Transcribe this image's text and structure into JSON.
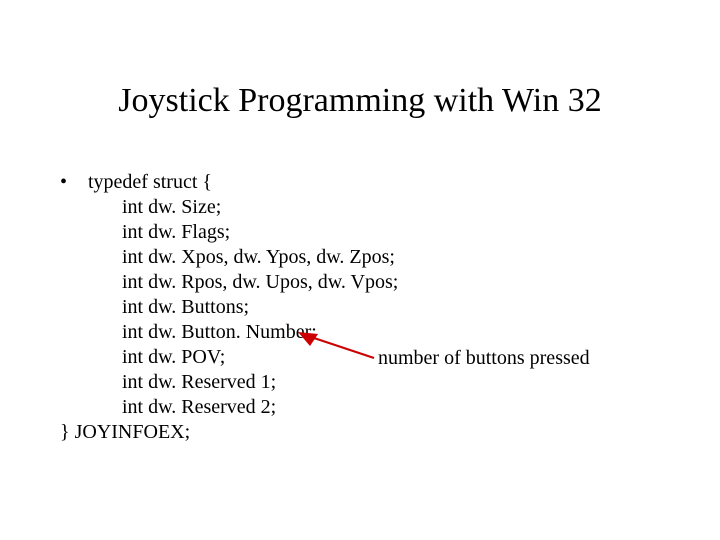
{
  "title": "Joystick Programming with Win 32",
  "bullet": {
    "marker": "•",
    "first_line": "typedef struct {",
    "lines": [
      "int dw. Size;",
      "int dw. Flags;",
      "int dw. Xpos, dw. Ypos, dw. Zpos;",
      "int dw. Rpos, dw. Upos, dw. Vpos;",
      "int dw. Buttons;",
      "int dw. Button. Number;",
      "int dw. POV;",
      "int dw. Reserved 1;",
      "int dw. Reserved 2;"
    ],
    "close_line": "} JOYINFOEX;"
  },
  "annotation": "number of buttons pressed"
}
